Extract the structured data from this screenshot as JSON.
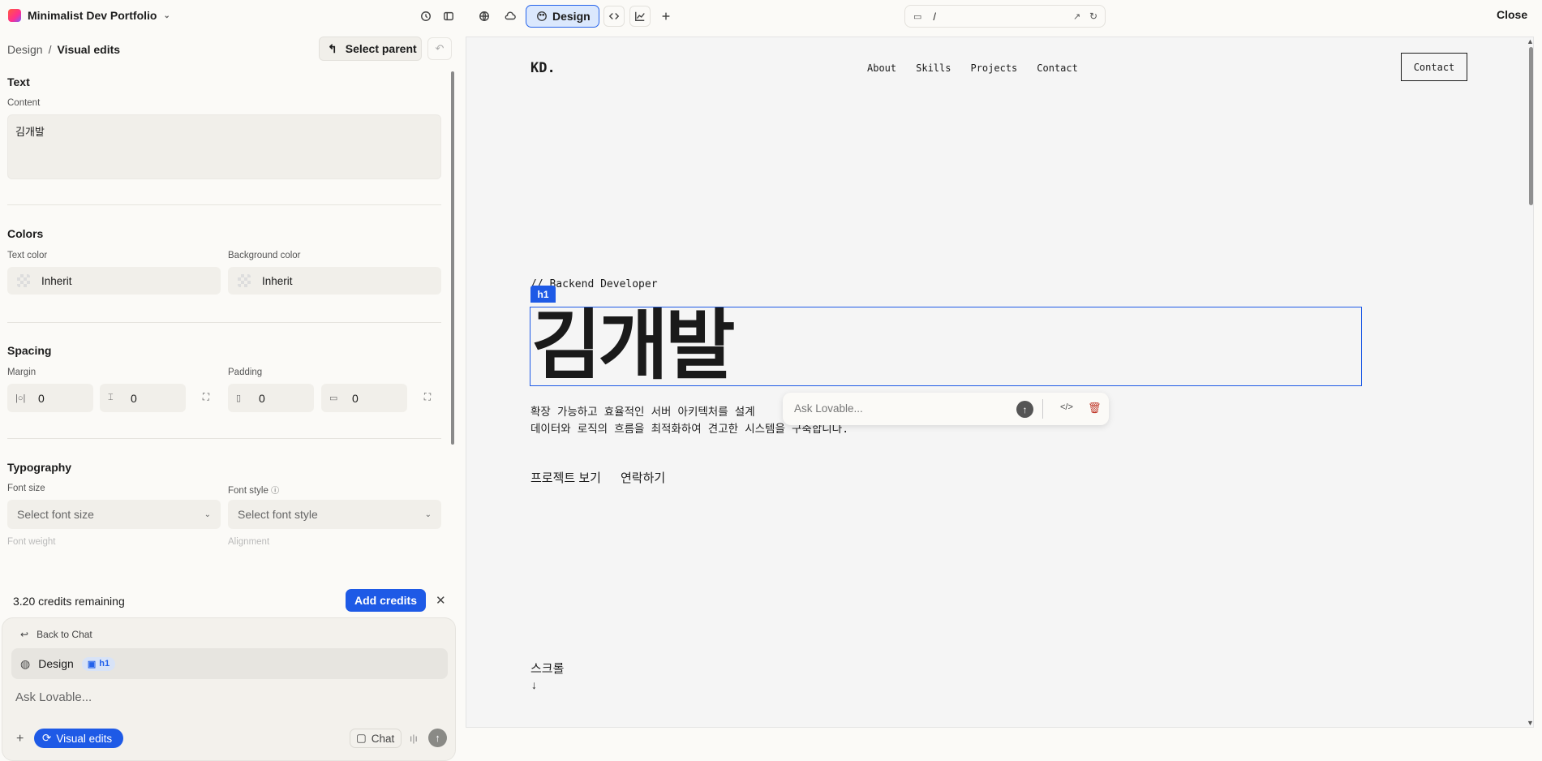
{
  "topbar": {
    "project_name": "Minimalist Dev Portfolio",
    "design_tab": "Design",
    "url_path": "/",
    "close_label": "Close"
  },
  "panel": {
    "breadcrumb": {
      "parent": "Design",
      "current": "Visual edits"
    },
    "select_parent_label": "Select parent",
    "text_section": {
      "title": "Text",
      "content_label": "Content",
      "content_value": "김개발"
    },
    "colors_section": {
      "title": "Colors",
      "text_color_label": "Text color",
      "text_color_value": "Inherit",
      "bg_color_label": "Background color",
      "bg_color_value": "Inherit"
    },
    "spacing_section": {
      "title": "Spacing",
      "margin_label": "Margin",
      "margin_x": "0",
      "margin_y": "0",
      "padding_label": "Padding",
      "padding_x": "0",
      "padding_y": "0"
    },
    "typography_section": {
      "title": "Typography",
      "font_size_label": "Font size",
      "font_size_placeholder": "Select font size",
      "font_style_label": "Font style",
      "font_style_placeholder": "Select font style",
      "font_weight_label": "Font weight",
      "alignment_label": "Alignment"
    }
  },
  "credits": {
    "text": "3.20 credits remaining",
    "add_label": "Add credits"
  },
  "chat": {
    "back_label": "Back to Chat",
    "chip_label": "Design",
    "chip_tag": "h1",
    "placeholder": "Ask Lovable...",
    "visual_edits_label": "Visual edits",
    "chat_label": "Chat"
  },
  "preview": {
    "logo": "KD.",
    "nav": [
      "About",
      "Skills",
      "Projects",
      "Contact"
    ],
    "contact_button": "Contact",
    "subtitle": "// Backend Developer",
    "element_badge": "h1",
    "heading": "김개발",
    "description_line1": "확장 가능하고 효율적인 서버 아키텍처를 설계",
    "description_line2": "데이터와 로직의 흐름을 최적화하여 견고한 시스템을 구축합니다.",
    "ask_placeholder": "Ask Lovable...",
    "cta_projects": "프로젝트 보기",
    "cta_contact": "연락하기",
    "scroll_label": "스크롤",
    "scroll_arrow": "↓"
  },
  "colors": {
    "accent": "#1e5ae6",
    "selection_bg": "#dbe8fd",
    "panel_bg": "#fbfaf7",
    "preview_bg": "#f5f5f5"
  }
}
